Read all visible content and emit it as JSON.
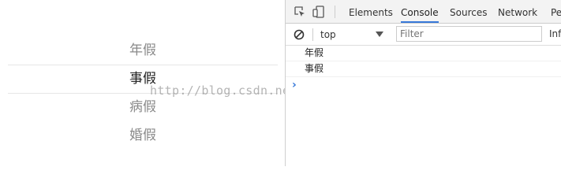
{
  "picker": {
    "items": [
      "年假",
      "事假",
      "病假",
      "婚假"
    ],
    "selected_index": 1
  },
  "watermark": "http://blog.csdn.net/michael_ouyang",
  "devtools": {
    "tabs": [
      "Elements",
      "Console",
      "Sources",
      "Network",
      "Per"
    ],
    "active_tab": "Console",
    "context": "top",
    "filter_placeholder": "Filter",
    "levels_label": "Info",
    "console_lines": [
      "年假",
      "事假"
    ],
    "prompt_symbol": "›",
    "icons": [
      "inspect-icon",
      "device-toolbar-icon",
      "clear-console-icon",
      "dropdown-arrow-icon",
      "prompt-chevron-icon"
    ],
    "accent_color": "#3879d9"
  }
}
